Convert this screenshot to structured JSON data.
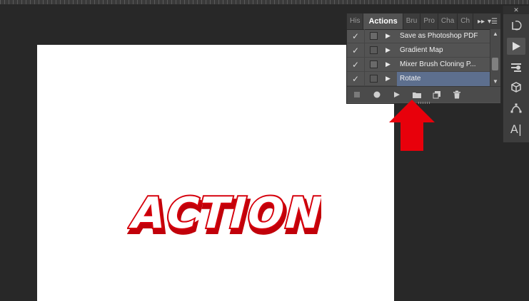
{
  "canvas": {
    "artwork_text": "ACTION"
  },
  "actions_panel": {
    "tabs": [
      {
        "label": "His",
        "active": false
      },
      {
        "label": "Actions",
        "active": true
      },
      {
        "label": "Bru",
        "active": false
      },
      {
        "label": "Pro",
        "active": false
      },
      {
        "label": "Cha",
        "active": false
      },
      {
        "label": "Ch",
        "active": false
      }
    ],
    "collapse_icon": "double-chevron-right-icon",
    "menu_icon": "panel-menu-icon",
    "actions": [
      {
        "name": "Save as Photoshop PDF",
        "checked": true,
        "has_dialog": true,
        "selected": false
      },
      {
        "name": "Gradient Map",
        "checked": true,
        "has_dialog": false,
        "selected": false
      },
      {
        "name": "Mixer Brush Cloning P...",
        "checked": true,
        "has_dialog": true,
        "selected": false
      },
      {
        "name": "Rotate",
        "checked": true,
        "has_dialog": false,
        "selected": true
      }
    ],
    "bottom_buttons": [
      "stop-icon",
      "record-icon",
      "play-icon",
      "new-set-icon",
      "new-action-icon",
      "delete-icon"
    ]
  },
  "tool_strip": {
    "tools": [
      "history-icon",
      "actions-play-icon",
      "brush-presets-icon",
      "3d-icon",
      "paths-icon",
      "character-icon"
    ]
  },
  "colors": {
    "highlight": "#e8000b",
    "selection": "#5d6f8e",
    "panel_bg": "#535353",
    "workspace_bg": "#282828"
  }
}
